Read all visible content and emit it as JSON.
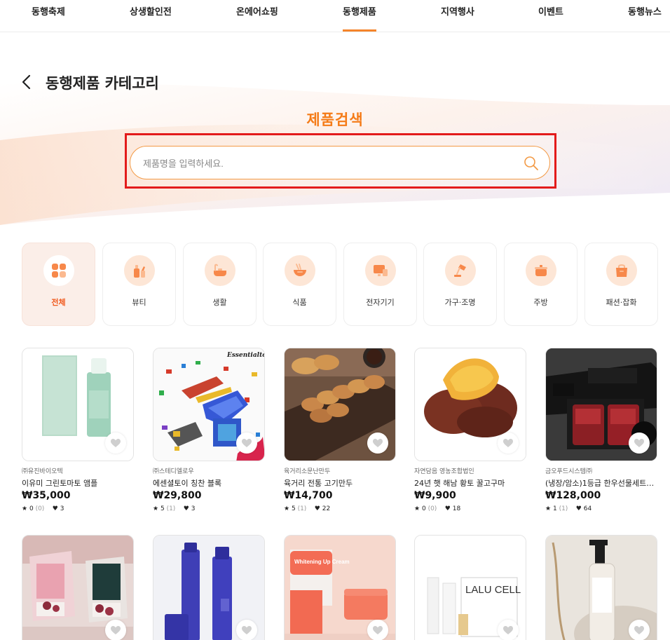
{
  "nav": {
    "items": [
      {
        "label": "동행축제"
      },
      {
        "label": "상생할인전"
      },
      {
        "label": "온에어쇼핑"
      },
      {
        "label": "동행제품",
        "active": true
      },
      {
        "label": "지역행사"
      },
      {
        "label": "이벤트"
      },
      {
        "label": "동행뉴스"
      }
    ],
    "accent": "#f5842a"
  },
  "header": {
    "title": "동행제품 카테고리",
    "back_icon": "chevron-left-icon"
  },
  "search": {
    "heading": "제품검색",
    "placeholder": "제품명을 입력하세요.",
    "value": "",
    "icon": "search-icon",
    "heading_color": "#f57b17",
    "highlight_color": "#e31b1b"
  },
  "categories": [
    {
      "label": "전체",
      "icon": "grid-icon",
      "active": true
    },
    {
      "label": "뷰티",
      "icon": "cosmetics-icon"
    },
    {
      "label": "생활",
      "icon": "bathtub-icon"
    },
    {
      "label": "식품",
      "icon": "noodle-bowl-icon"
    },
    {
      "label": "전자기기",
      "icon": "monitor-icon"
    },
    {
      "label": "가구·조명",
      "icon": "desk-lamp-icon"
    },
    {
      "label": "주방",
      "icon": "pot-icon"
    },
    {
      "label": "패션·잡화",
      "icon": "shopping-bag-icon"
    }
  ],
  "products": [
    {
      "seller": "㈜유진바이오텍",
      "name": "이유미 그린토마토 앰플",
      "price": "₩35,000",
      "rating": "0",
      "reviews": "(0)",
      "likes": "3"
    },
    {
      "seller": "㈜스테디엘로우",
      "name": "에센셜토이 칭찬 블록",
      "price": "₩29,800",
      "rating": "5",
      "reviews": "(1)",
      "likes": "3",
      "image_text": "Essentialtoy"
    },
    {
      "seller": "육거리소문난만두",
      "name": "육거리 전통 고기만두",
      "price": "₩14,700",
      "rating": "5",
      "reviews": "(1)",
      "likes": "22"
    },
    {
      "seller": "자연담음 영농조합법인",
      "name": "24년 햇 해남 황토 꿀고구마",
      "price": "₩9,900",
      "rating": "0",
      "reviews": "(0)",
      "likes": "18"
    },
    {
      "seller": "금오푸드시스템㈜",
      "name": "(냉장/암소)1등급 한우선물세트1...",
      "price": "₩128,000",
      "rating": "1",
      "reviews": "(1)",
      "likes": "64"
    },
    {
      "seller": "",
      "name": "",
      "price": ""
    },
    {
      "seller": "",
      "name": "",
      "price": ""
    },
    {
      "seller": "",
      "name": "",
      "price": "",
      "image_text": "Whitening Up Cream"
    },
    {
      "seller": "",
      "name": "",
      "price": "",
      "image_text": "LALU CELL"
    },
    {
      "seller": "",
      "name": "",
      "price": ""
    }
  ],
  "icons": {
    "heart": "heart-icon",
    "star": "star-icon",
    "like": "heart-small-icon"
  }
}
